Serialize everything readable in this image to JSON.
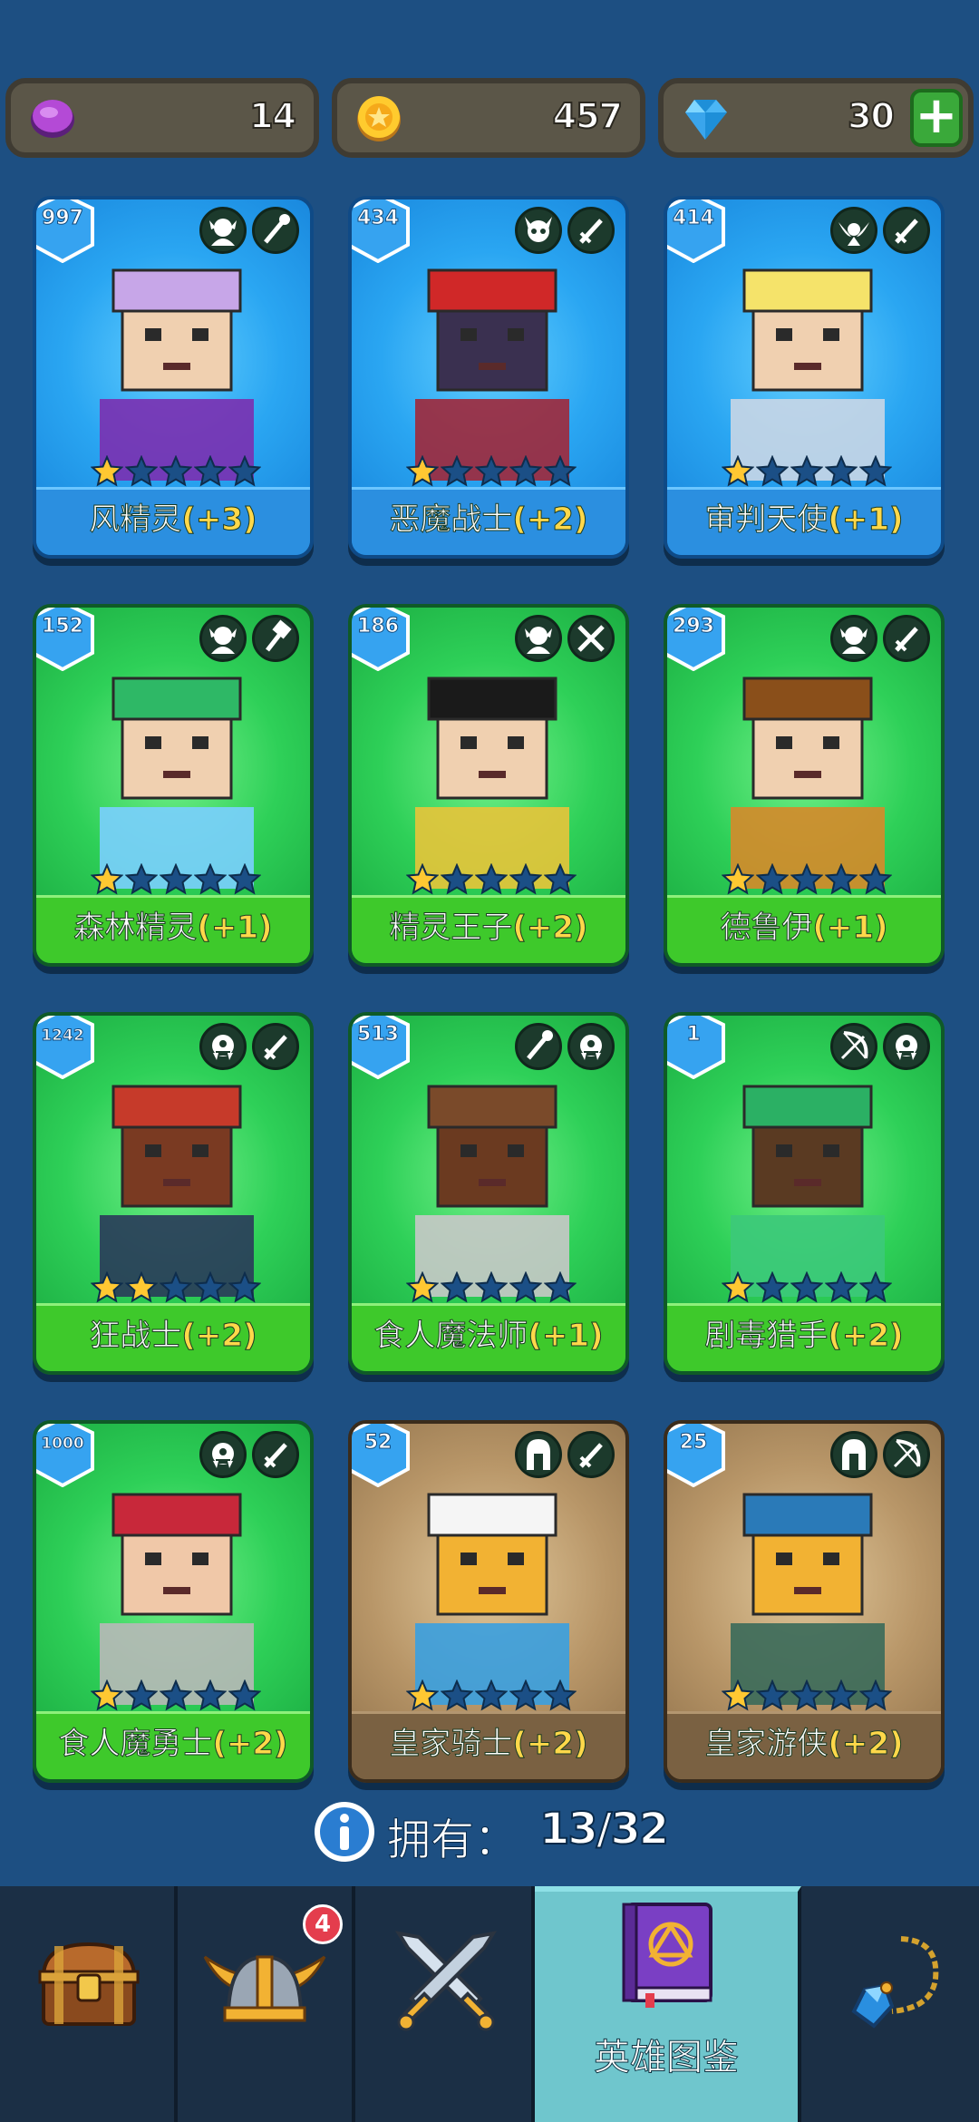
{
  "resources": {
    "gems": "14",
    "coins": "457",
    "diamonds": "30",
    "plus": "+"
  },
  "cards": [
    {
      "level": "997",
      "name": "风精灵",
      "bonus": "(+3)",
      "stars": 1,
      "theme": "blue",
      "icons": [
        "elf-icon",
        "staff-icon"
      ]
    },
    {
      "level": "434",
      "name": "恶魔战士",
      "bonus": "(+2)",
      "stars": 1,
      "theme": "blue",
      "icons": [
        "demon-icon",
        "sword-icon"
      ]
    },
    {
      "level": "414",
      "name": "审判天使",
      "bonus": "(+1)",
      "stars": 1,
      "theme": "blue",
      "icons": [
        "angel-icon",
        "sword-icon"
      ]
    },
    {
      "level": "152",
      "name": "森林精灵",
      "bonus": "(+1)",
      "stars": 1,
      "theme": "green",
      "icons": [
        "elf-icon",
        "hammer-icon"
      ]
    },
    {
      "level": "186",
      "name": "精灵王子",
      "bonus": "(+2)",
      "stars": 1,
      "theme": "green",
      "icons": [
        "elf-icon",
        "crossed-swords-icon"
      ]
    },
    {
      "level": "293",
      "name": "德鲁伊",
      "bonus": "(+1)",
      "stars": 1,
      "theme": "green",
      "icons": [
        "elf-icon",
        "sword-icon"
      ]
    },
    {
      "level": "1242",
      "name": "狂战士",
      "bonus": "(+2)",
      "stars": 2,
      "theme": "green",
      "icons": [
        "ogre-icon",
        "sword-icon"
      ]
    },
    {
      "level": "513",
      "name": "食人魔法师",
      "bonus": "(+1)",
      "stars": 1,
      "theme": "green",
      "icons": [
        "staff-icon",
        "ogre-icon"
      ]
    },
    {
      "level": "1",
      "name": "剧毒猎手",
      "bonus": "(+2)",
      "stars": 1,
      "theme": "green",
      "icons": [
        "bow-icon",
        "ogre-icon"
      ]
    },
    {
      "level": "1000",
      "name": "食人魔勇士",
      "bonus": "(+2)",
      "stars": 1,
      "theme": "green",
      "icons": [
        "ogre-icon",
        "sword-icon"
      ]
    },
    {
      "level": "52",
      "name": "皇家骑士",
      "bonus": "(+2)",
      "stars": 1,
      "theme": "brown",
      "icons": [
        "helmet-icon",
        "sword-icon"
      ]
    },
    {
      "level": "25",
      "name": "皇家游侠",
      "bonus": "(+2)",
      "stars": 1,
      "theme": "brown",
      "icons": [
        "helmet-icon",
        "bow-icon"
      ]
    }
  ],
  "owned": {
    "label": "拥有：",
    "value": "13/32"
  },
  "nav": {
    "notification_count": "4",
    "active_label": "英雄图鉴"
  },
  "colors": {
    "background": "#1d4f82",
    "bonus": "#ffd84a",
    "star_filled": "#ffc832",
    "star_empty": "#1b4f86"
  }
}
